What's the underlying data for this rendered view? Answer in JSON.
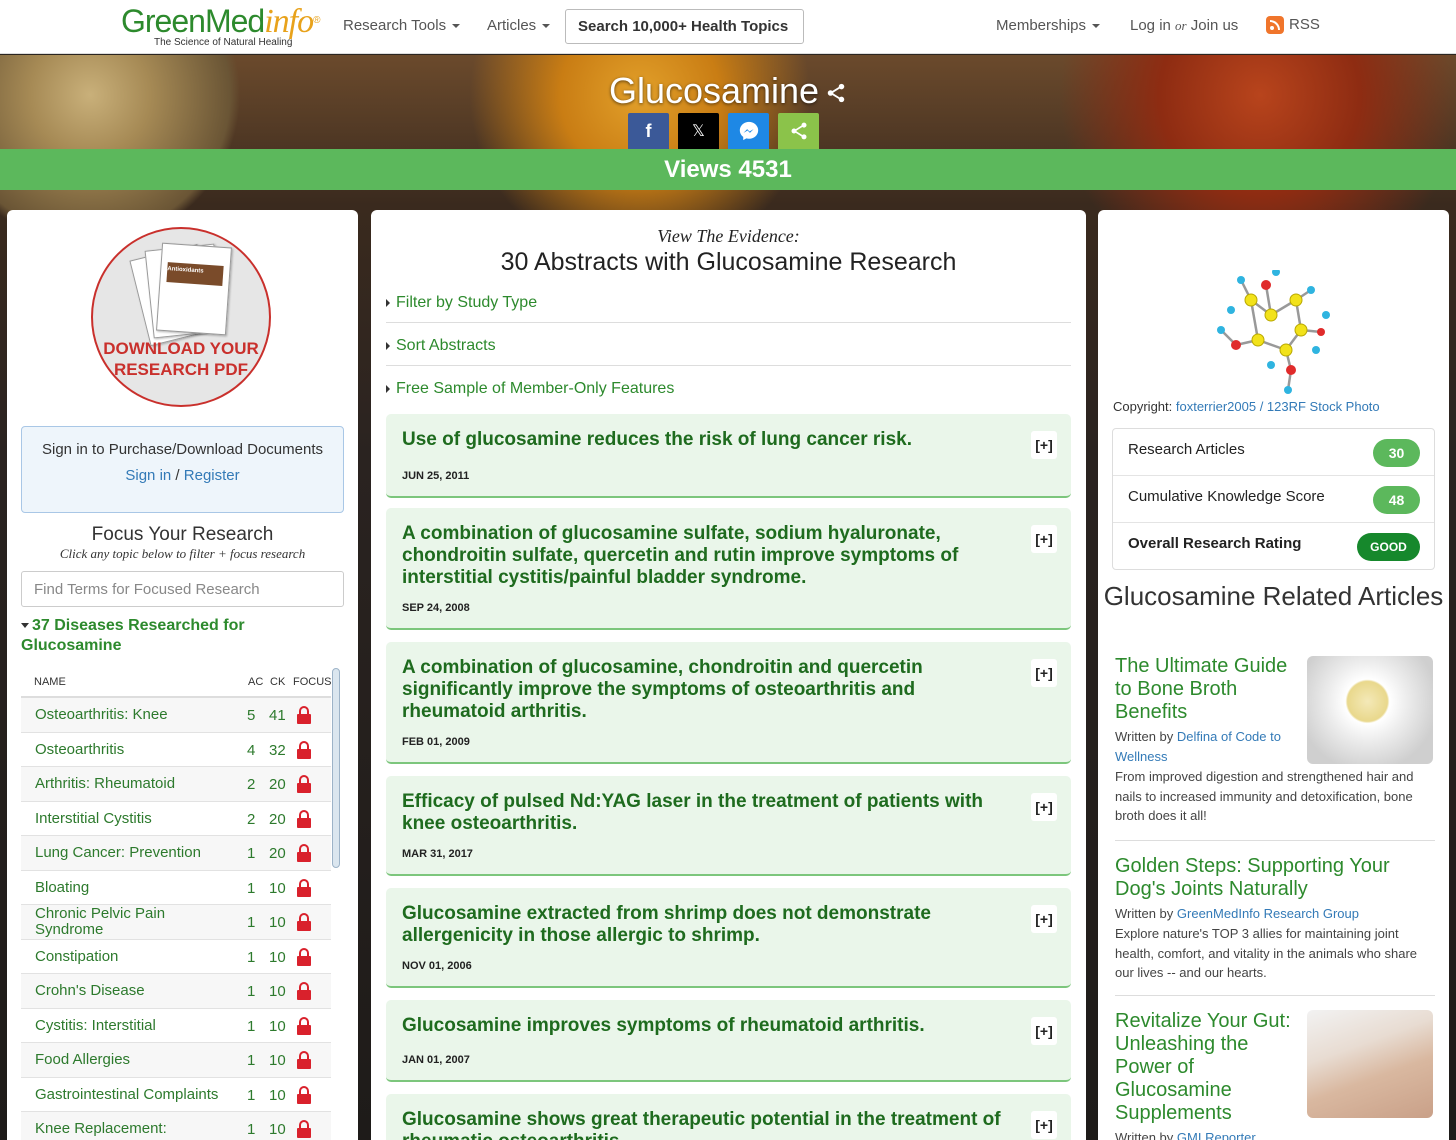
{
  "nav": {
    "logo_green": "GreenMed",
    "logo_info": "info",
    "logo_reg": "®",
    "tagline": "The Science of Natural Healing",
    "research_tools": "Research Tools",
    "articles": "Articles",
    "search": "Search 10,000+ Health Topics",
    "memberships": "Memberships",
    "login": "Log in",
    "or": "or",
    "join": "Join us",
    "rss": "RSS"
  },
  "hero": {
    "title": "Glucosamine",
    "views": "Views 4531",
    "share_buttons": [
      {
        "icon": "facebook-icon",
        "glyph": "f",
        "color": "#3b5998"
      },
      {
        "icon": "x-icon",
        "glyph": "𝕏",
        "color": "#000000"
      },
      {
        "icon": "messenger-icon",
        "glyph": "",
        "color": "#1e88e5"
      },
      {
        "icon": "share-icon",
        "glyph": "",
        "color": "#8bc34a"
      }
    ]
  },
  "left": {
    "pdf_line1": "DOWNLOAD YOUR",
    "pdf_line2": "RESEARCH PDF",
    "pdf_doc_title": "Antioxidants",
    "sign_text": "Sign in to Purchase/Download Documents",
    "sign_in": "Sign in",
    "slash": "/",
    "register": "Register",
    "focus_title": "Focus Your Research",
    "focus_sub": "Click any topic below to filter + focus research",
    "find_placeholder": "Find Terms for Focused Research",
    "diseases_heading": "37 Diseases Researched for Glucosamine",
    "columns": [
      "NAME",
      "AC",
      "CK",
      "FOCUS"
    ],
    "rows": [
      {
        "name": "Osteoarthritis: Knee",
        "ac": "5",
        "ck": "41"
      },
      {
        "name": "Osteoarthritis",
        "ac": "4",
        "ck": "32"
      },
      {
        "name": "Arthritis: Rheumatoid",
        "ac": "2",
        "ck": "20"
      },
      {
        "name": "Interstitial Cystitis",
        "ac": "2",
        "ck": "20"
      },
      {
        "name": "Lung Cancer: Prevention",
        "ac": "1",
        "ck": "20"
      },
      {
        "name": "Bloating",
        "ac": "1",
        "ck": "10"
      },
      {
        "name": "Chronic Pelvic Pain Syndrome",
        "ac": "1",
        "ck": "10"
      },
      {
        "name": "Constipation",
        "ac": "1",
        "ck": "10"
      },
      {
        "name": "Crohn's Disease",
        "ac": "1",
        "ck": "10"
      },
      {
        "name": "Cystitis: Interstitial",
        "ac": "1",
        "ck": "10"
      },
      {
        "name": "Food Allergies",
        "ac": "1",
        "ck": "10"
      },
      {
        "name": "Gastrointestinal Complaints",
        "ac": "1",
        "ck": "10"
      },
      {
        "name": "Knee Replacement:",
        "ac": "1",
        "ck": "10"
      }
    ]
  },
  "mid": {
    "eyebrow": "View The Evidence:",
    "heading": "30 Abstracts with Glucosamine Research",
    "filters": [
      "Filter by Study Type",
      "Sort Abstracts",
      "Free Sample of Member-Only Features"
    ],
    "expand_label": "[+]",
    "abstracts": [
      {
        "title": "Use of glucosamine reduces the risk of lung cancer risk.",
        "date": "JUN 25, 2011"
      },
      {
        "title": "A combination of glucosamine sulfate, sodium hyaluronate, chondroitin sulfate, quercetin and rutin improve symptoms of interstitial cystitis/painful bladder syndrome.",
        "date": "SEP 24, 2008"
      },
      {
        "title": "A combination of glucosamine, chondroitin and quercetin significantly improve the symptoms of osteoarthritis and rheumatoid arthritis.",
        "date": "FEB 01, 2009"
      },
      {
        "title": "Efficacy of pulsed Nd:YAG laser in the treatment of patients with knee osteoarthritis.",
        "date": "MAR 31, 2017"
      },
      {
        "title": "Glucosamine extracted from shrimp does not demonstrate allergenicity in those allergic to shrimp.",
        "date": "NOV 01, 2006"
      },
      {
        "title": "Glucosamine improves symptoms of rheumatoid arthritis.",
        "date": "JAN 01, 2007"
      },
      {
        "title": "Glucosamine shows great therapeutic potential in the treatment of rheumatic osteoarthritis",
        "date": ""
      }
    ]
  },
  "right": {
    "copyright_label": "Copyright:",
    "copyright_link": "foxterrier2005 / 123RF Stock Photo",
    "stats": [
      {
        "label": "Research Articles",
        "value": "30"
      },
      {
        "label": "Cumulative Knowledge Score",
        "value": "48"
      },
      {
        "label": "Overall Research Rating",
        "value": "GOOD"
      }
    ],
    "related_heading": "Glucosamine Related Articles",
    "written_by": "Written by",
    "articles": [
      {
        "title": "The Ultimate Guide to Bone Broth Benefits",
        "author": "Delfina of Code to Wellness",
        "desc": "From improved digestion and strengthened hair and nails to increased immunity and detoxification, bone broth does it all!"
      },
      {
        "title": "Golden Steps: Supporting Your Dog's Joints Naturally",
        "author": "GreenMedInfo Research Group",
        "desc": "Explore nature's TOP 3 allies for maintaining joint health, comfort, and vitality in the animals who share our lives -- and our hearts."
      },
      {
        "title": "Revitalize Your Gut: Unleashing the Power of Glucosamine Supplements",
        "author": "GMI Reporter",
        "desc": ""
      }
    ]
  }
}
